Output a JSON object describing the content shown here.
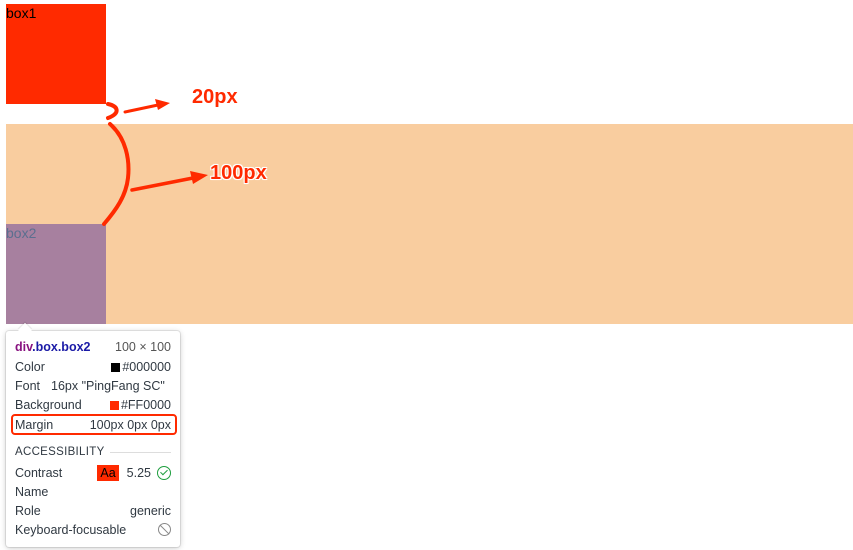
{
  "boxes": {
    "box1_label": "box1",
    "box2_label": "box2"
  },
  "annotations": {
    "small_margin": "20px",
    "large_margin": "100px",
    "color": "#ff2a00"
  },
  "tooltip": {
    "tag": "div",
    "classes": ".box.box2",
    "dimensions": "100 × 100",
    "rows": [
      {
        "label": "Color",
        "value": "#000000",
        "swatch": "#000000"
      },
      {
        "label": "Font",
        "value": "16px \"PingFang SC\""
      },
      {
        "label": "Background",
        "value": "#FF0000",
        "swatch": "#ff2a00"
      },
      {
        "label": "Margin",
        "value": "100px 0px 0px"
      }
    ],
    "accessibility": {
      "heading": "ACCESSIBILITY",
      "contrast_label": "Contrast",
      "contrast_sample": "Aa",
      "contrast_value": "5.25",
      "name_label": "Name",
      "role_label": "Role",
      "role_value": "generic",
      "focusable_label": "Keyboard-focusable"
    }
  },
  "colors": {
    "box1": "#ff2a00",
    "band": "#f9cd9f",
    "box2": "#a7809f"
  }
}
